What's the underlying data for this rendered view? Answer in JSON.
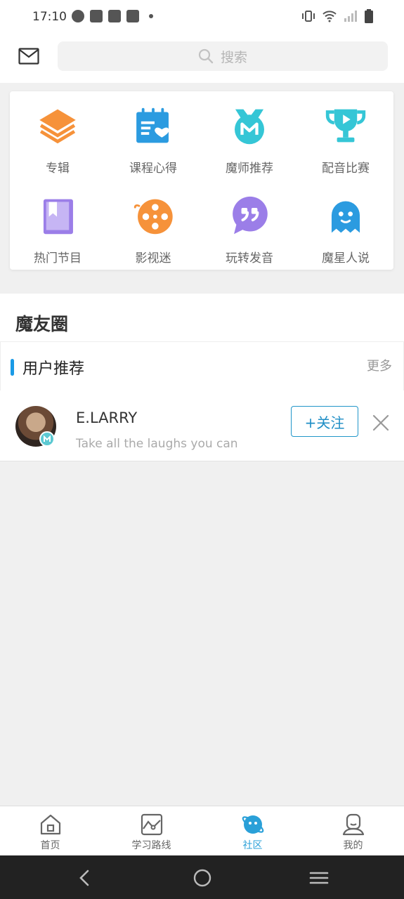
{
  "status_bar": {
    "time": "17:10",
    "left_icons": [
      "clock-icon",
      "bag-icon",
      "bag-icon",
      "bag-icon",
      "dot-icon"
    ],
    "right_icons": [
      "vibrate-icon",
      "wifi-icon",
      "signal-icon",
      "battery-icon"
    ]
  },
  "header": {
    "mail_icon": "mail-icon",
    "search_placeholder": "搜索"
  },
  "categories": [
    {
      "label": "专辑",
      "icon": "layers-icon",
      "color": "#f6923a"
    },
    {
      "label": "课程心得",
      "icon": "notebook-heart-icon",
      "color": "#2b9be0"
    },
    {
      "label": "魔师推荐",
      "icon": "medal-m-icon",
      "color": "#35c6d6"
    },
    {
      "label": "配音比赛",
      "icon": "trophy-icon",
      "color": "#35c6d6"
    },
    {
      "label": "热门节目",
      "icon": "book-icon",
      "color": "#9b7ee8"
    },
    {
      "label": "影视迷",
      "icon": "film-reel-icon",
      "color": "#f6923a"
    },
    {
      "label": "玩转发音",
      "icon": "quote-bubble-icon",
      "color": "#9b7ee8"
    },
    {
      "label": "魔星人说",
      "icon": "ghost-icon",
      "color": "#2b9be0"
    }
  ],
  "community": {
    "title": "魔友圈",
    "recommend_title": "用户推荐",
    "more_label": "更多"
  },
  "recommended_user": {
    "name": "E.LARRY",
    "bio": "Take all the laughs you can",
    "follow_label": "+关注"
  },
  "bottom_nav": [
    {
      "label": "首页",
      "icon": "home-icon",
      "active": false
    },
    {
      "label": "学习路线",
      "icon": "route-icon",
      "active": false
    },
    {
      "label": "社区",
      "icon": "planet-icon",
      "active": true
    },
    {
      "label": "我的",
      "icon": "profile-icon",
      "active": false
    }
  ],
  "colors": {
    "accent": "#2aa0d8",
    "follow_border": "#2196c9"
  }
}
